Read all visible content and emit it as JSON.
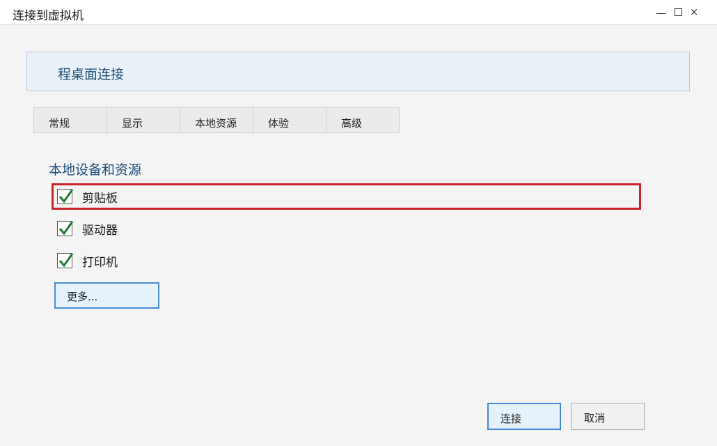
{
  "window": {
    "title": "连接到虚拟机",
    "controls": {
      "minimize": "minimize-icon",
      "maximize": "maximize-icon",
      "close": "×"
    }
  },
  "banner": {
    "title": "程桌面连接"
  },
  "tabs": [
    {
      "label": "常规"
    },
    {
      "label": "显示"
    },
    {
      "label": "本地资源"
    },
    {
      "label": "体验"
    },
    {
      "label": "高级"
    }
  ],
  "section": {
    "title": "本地设备和资源",
    "items": [
      {
        "label": "剪贴板",
        "checked": true,
        "highlighted": true
      },
      {
        "label": "驱动器",
        "checked": true,
        "highlighted": false
      },
      {
        "label": "打印机",
        "checked": true,
        "highlighted": false
      }
    ],
    "more_label": "更多..."
  },
  "footer": {
    "connect_label": "连接",
    "cancel_label": "取消"
  },
  "colors": {
    "accent_text": "#1f4e79",
    "highlight_border": "#c9242a",
    "check": "#1e7d32",
    "primary_border": "#3d89d1"
  }
}
